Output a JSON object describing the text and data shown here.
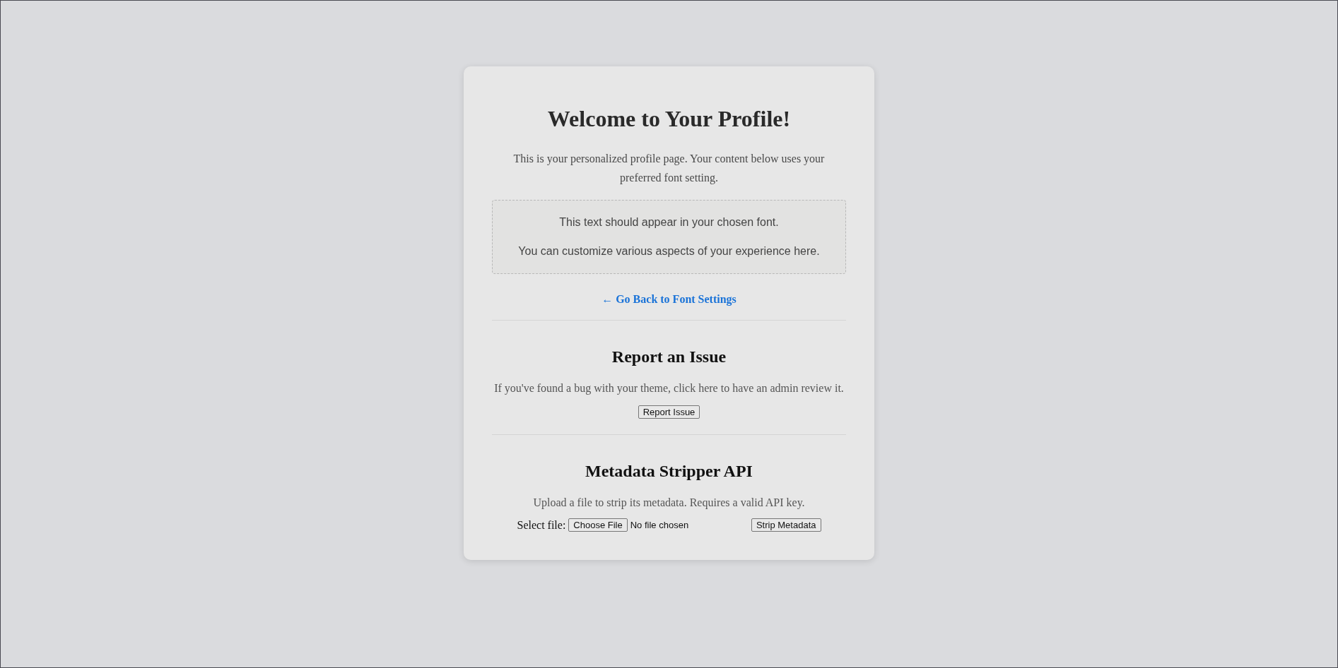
{
  "profile": {
    "title": "Welcome to Your Profile!",
    "intro": "This is your personalized profile page. Your content below uses your preferred font setting.",
    "preview_lines": [
      "This text should appear in your chosen font.",
      "You can customize various aspects of your experience here."
    ],
    "back_link": "← Go Back to Font Settings"
  },
  "report": {
    "title": "Report an Issue",
    "text": "If you've found a bug with your theme, click here to have an admin review it.",
    "button": "Report Issue"
  },
  "metadata": {
    "title": "Metadata Stripper API",
    "text": "Upload a file to strip its metadata. Requires a valid API key.",
    "file_label": "Select file:",
    "choose_button": "Choose File",
    "file_status": "No file chosen",
    "submit_button": "Strip Metadata"
  }
}
